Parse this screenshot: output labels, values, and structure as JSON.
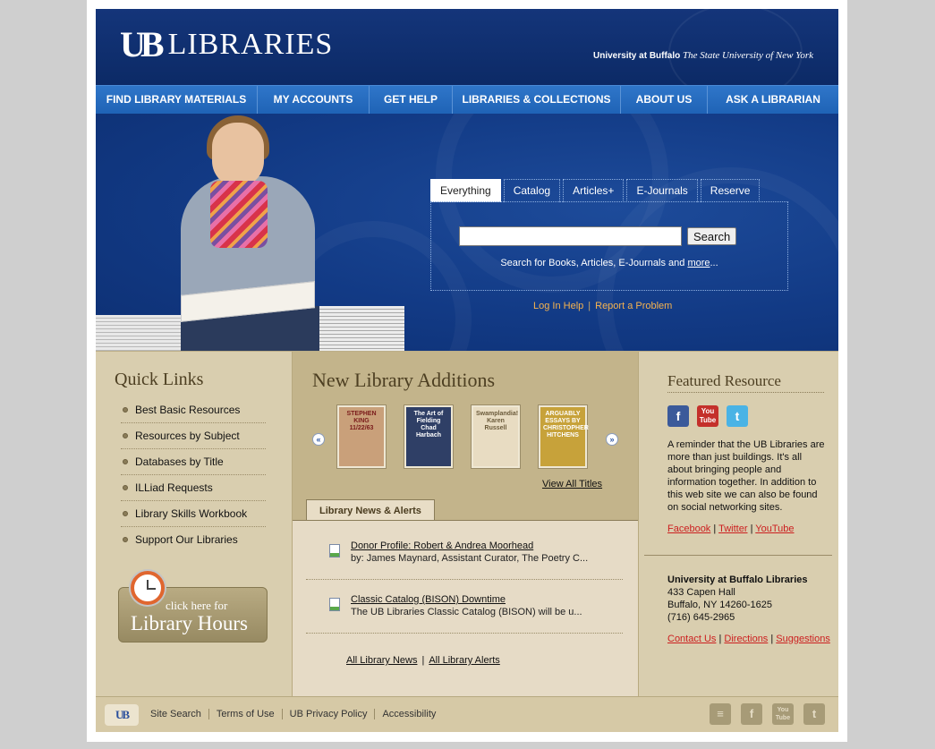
{
  "header": {
    "logo_mark": "UB",
    "logo_text": "LIBRARIES",
    "tagline_bold": "University at Buffalo",
    "tagline_italic": "The State University of New York"
  },
  "nav": {
    "items": [
      {
        "label": "FIND LIBRARY MATERIALS"
      },
      {
        "label": "MY ACCOUNTS"
      },
      {
        "label": "GET HELP"
      },
      {
        "label": "LIBRARIES & COLLECTIONS"
      },
      {
        "label": "ABOUT US"
      },
      {
        "label": "ASK A LIBRARIAN"
      }
    ]
  },
  "search": {
    "tabs": [
      {
        "label": "Everything",
        "active": true
      },
      {
        "label": "Catalog"
      },
      {
        "label": "Articles+"
      },
      {
        "label": "E-Journals"
      },
      {
        "label": "Reserve"
      }
    ],
    "input_value": "",
    "button_label": "Search",
    "hint_prefix": "Search for Books, Articles, E-Journals and ",
    "hint_link": "more",
    "hint_suffix": "...",
    "login_help": "Log In Help",
    "report_problem": "Report a Problem",
    "separator": "|"
  },
  "quick_links": {
    "title": "Quick Links",
    "items": [
      "Best Basic Resources",
      "Resources by Subject",
      "Databases by Title",
      "ILLiad Requests",
      "Library Skills Workbook",
      "Support Our Libraries"
    ],
    "hours_small": "click here for",
    "hours_big": "Library Hours"
  },
  "new_additions": {
    "title": "New Library Additions",
    "books": [
      {
        "cover_text": "STEPHEN KING 11/22/63",
        "color": "#c9a07a"
      },
      {
        "cover_text": "The Art of Fielding Chad Harbach",
        "color": "#2f3f66"
      },
      {
        "cover_text": "Swamplandia! Karen Russell",
        "color": "#e8dcc2"
      },
      {
        "cover_text": "ARGUABLY ESSAYS BY CHRISTOPHER HITCHENS",
        "color": "#c7a23a"
      }
    ],
    "prev_icon": "chevron-left-icon",
    "next_icon": "chevron-right-icon",
    "view_all": "View All Titles"
  },
  "news": {
    "tab_label": "Library News & Alerts",
    "items": [
      {
        "title": "Donor Profile: Robert & Andrea Moorhead",
        "desc": "by: James Maynard, Assistant Curator, The Poetry C..."
      },
      {
        "title": "Classic Catalog (BISON) Downtime",
        "desc": "The UB Libraries Classic Catalog (BISON) will be u..."
      }
    ],
    "all_news": "All Library News",
    "all_alerts": "All Library Alerts",
    "separator": "|"
  },
  "featured": {
    "title": "Featured Resource",
    "social_icons": [
      "facebook-icon",
      "youtube-icon",
      "twitter-icon"
    ],
    "fb_glyph": "f",
    "yt_glyph": "You Tube",
    "tw_glyph": "t",
    "description": "A reminder that the UB Libraries are more than just buildings. It's all about bringing people and information together. In addition to this web site we can also be found on social networking sites.",
    "links": [
      "Facebook",
      "Twitter",
      "YouTube"
    ],
    "separator": "|"
  },
  "address": {
    "name": "University at Buffalo Libraries",
    "street": "433 Capen Hall",
    "city": "Buffalo, NY 14260-1625",
    "phone": "(716) 645-2965",
    "links": [
      "Contact Us",
      "Directions",
      "Suggestions"
    ]
  },
  "footer": {
    "logo": "UB",
    "links": [
      "Site Search",
      "Terms of Use",
      "UB Privacy Policy",
      "Accessibility"
    ],
    "icons": [
      "rss-icon",
      "facebook-icon",
      "youtube-icon",
      "twitter-icon"
    ],
    "rss_glyph": "≡",
    "fb_glyph": "f",
    "yt_glyph": "You Tube",
    "tw_glyph": "t"
  },
  "colors": {
    "header_blue": "#0e2d6c",
    "nav_blue": "#2f76c9",
    "tan": "#d8ccab",
    "link_red": "#cc1f1f",
    "hero_link_orange": "#f6b34f"
  }
}
